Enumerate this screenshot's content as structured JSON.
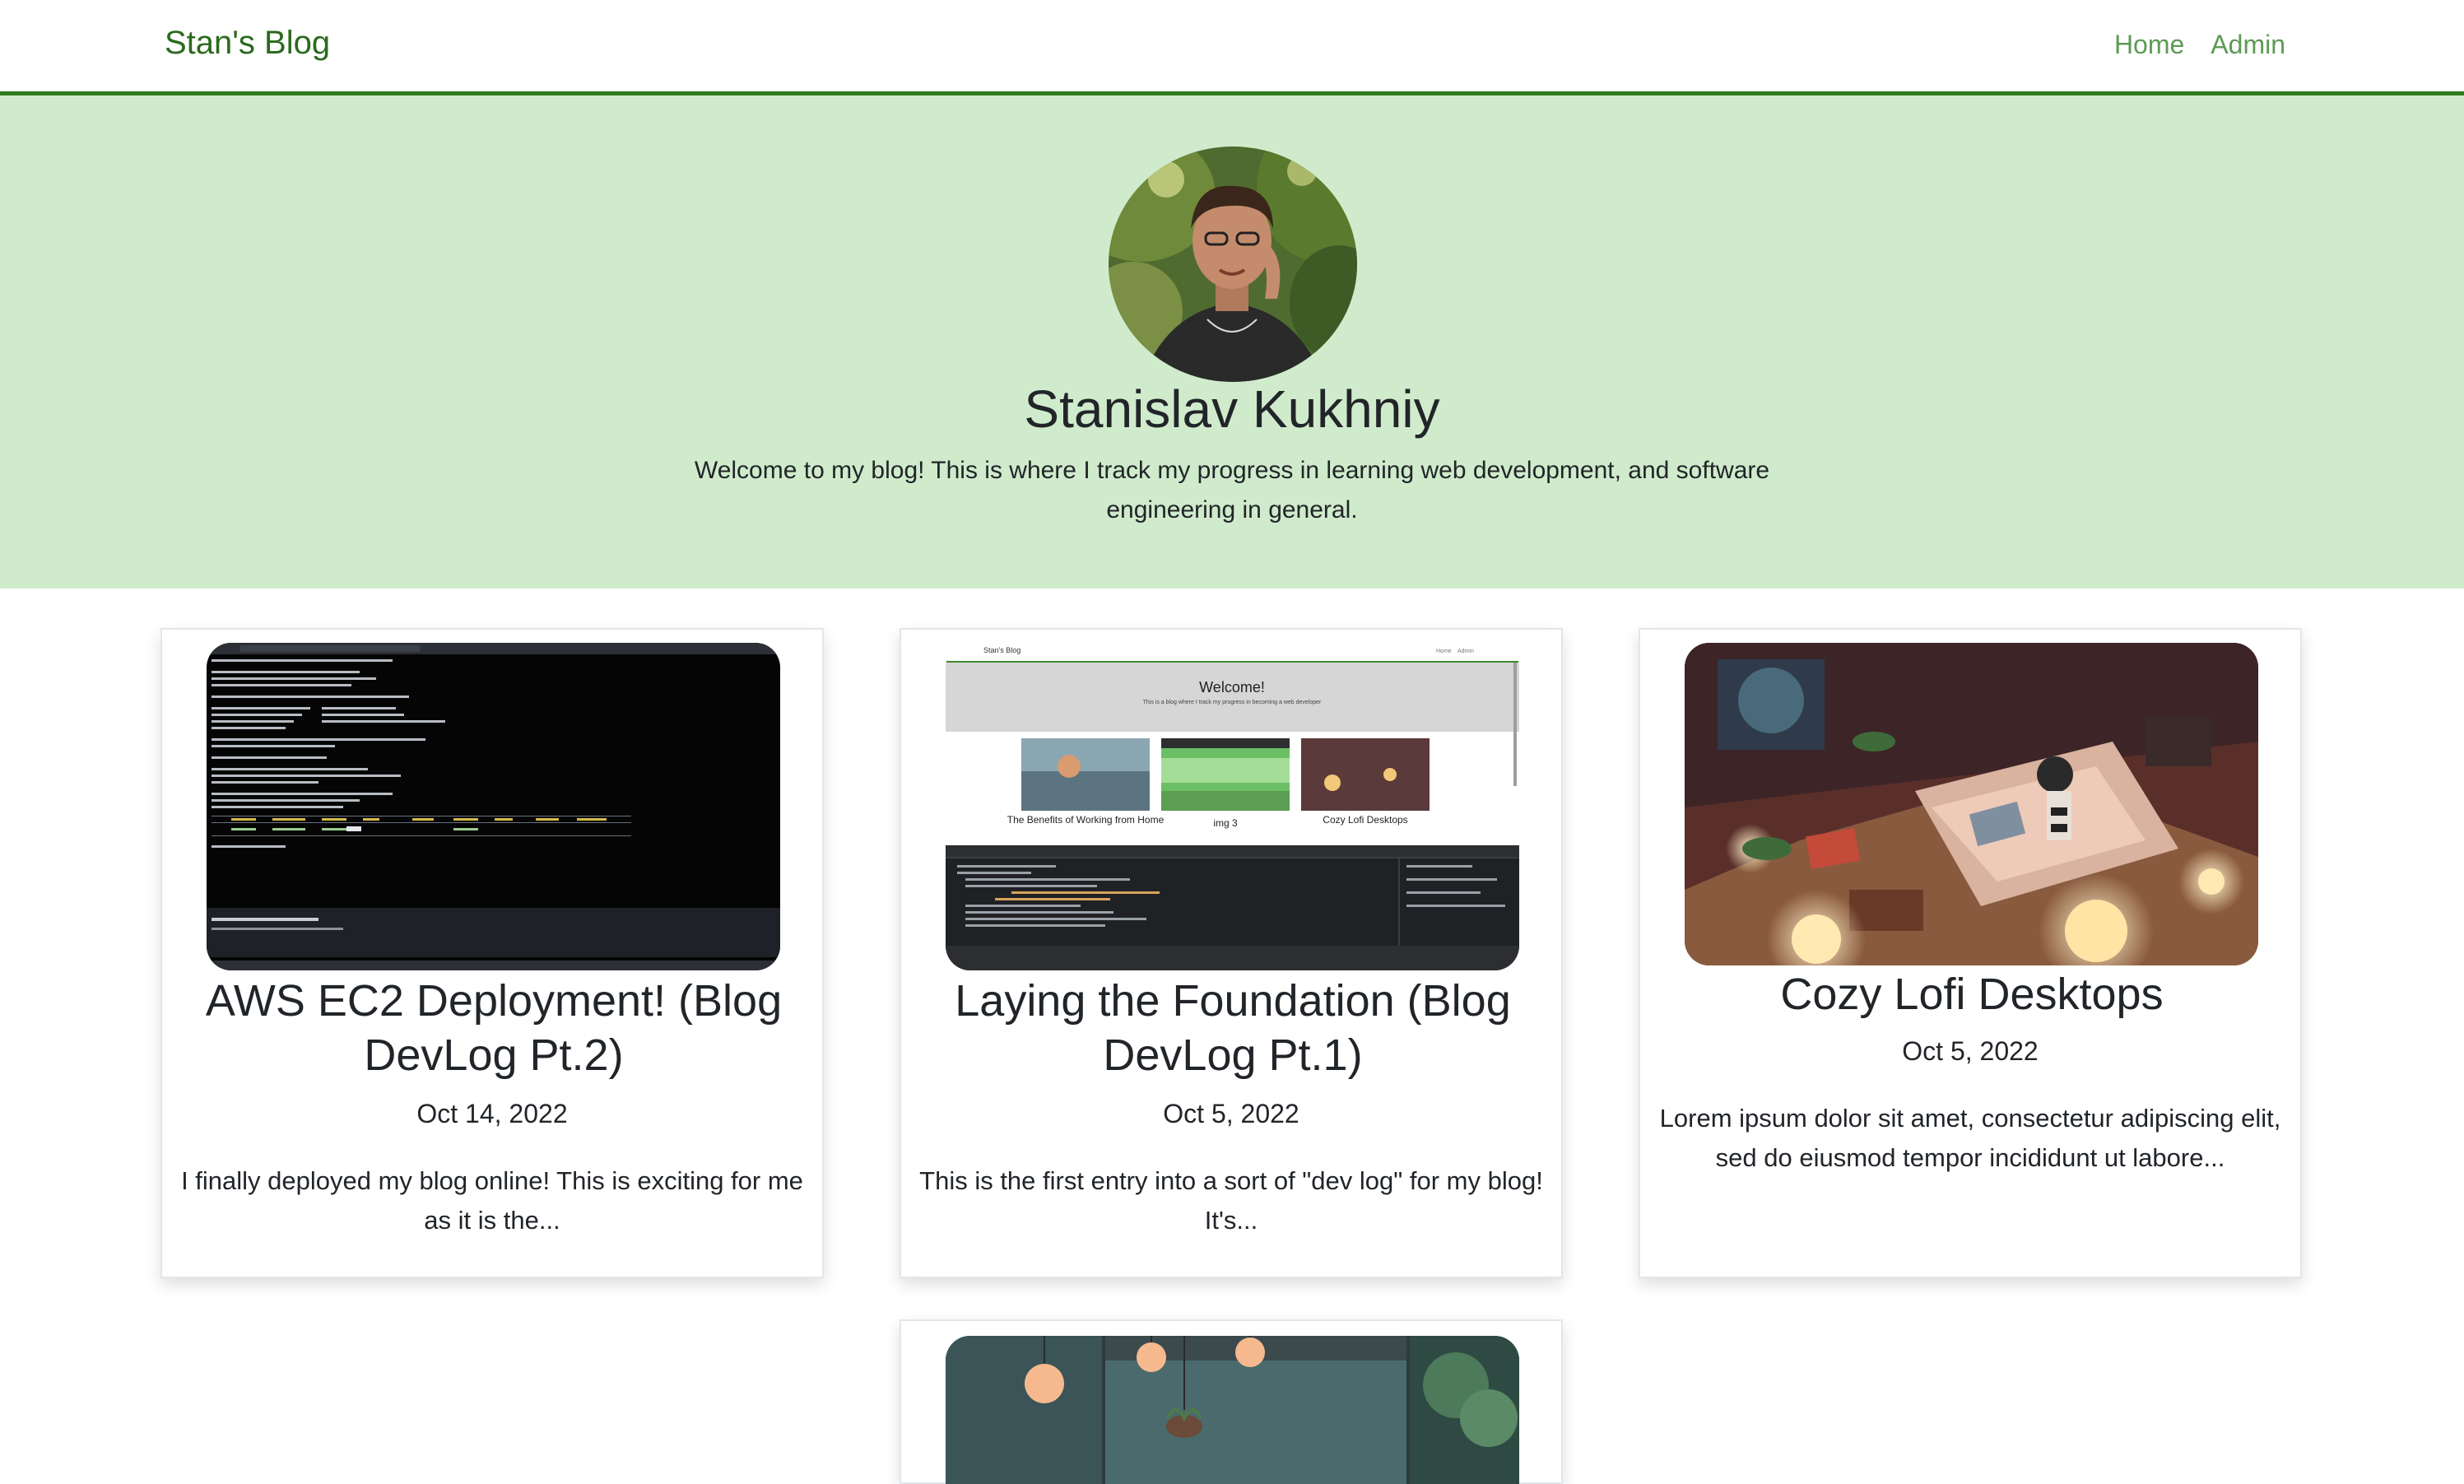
{
  "navbar": {
    "brand": "Stan's Blog",
    "links": [
      "Home",
      "Admin"
    ],
    "accent_color": "#2e7d1f"
  },
  "hero": {
    "name": "Stanislav Kukhniy",
    "intro": "Welcome to my blog! This is where I track my progress in learning web development, and software engineering in general.",
    "background_color": "#d0ebcb",
    "avatar_icon": "profile-photo"
  },
  "posts": [
    {
      "title": "AWS EC2 Deployment! (Blog DevLog Pt.2)",
      "date": "Oct 14, 2022",
      "excerpt": "I finally deployed my blog online! This is exciting for me as it is the...",
      "thumbnail": "terminal-screenshot"
    },
    {
      "title": "Laying the Foundation (Blog DevLog Pt.1)",
      "date": "Oct 5, 2022",
      "excerpt": "This is the first entry into a sort of \"dev log\" for my blog! It's...",
      "thumbnail": "blog-devtools-screenshot",
      "preview": {
        "brand": "Stan's Blog",
        "links": [
          "Home",
          "Admin"
        ],
        "heading": "Welcome!",
        "subheading": "This is a blog where I track my progress in becoming a web developer",
        "cards": [
          "The Benefits of Working from Home",
          "img 3",
          "Cozy Lofi Desktops"
        ]
      }
    },
    {
      "title": "Cozy Lofi Desktops",
      "date": "Oct 5, 2022",
      "excerpt": "Lorem ipsum dolor sit amet, consectetur adipiscing elit, sed do eiusmod tempor incididunt ut labore...",
      "thumbnail": "lofi-bedroom-illustration"
    },
    {
      "thumbnail": "lofi-room-lamps-illustration"
    }
  ]
}
